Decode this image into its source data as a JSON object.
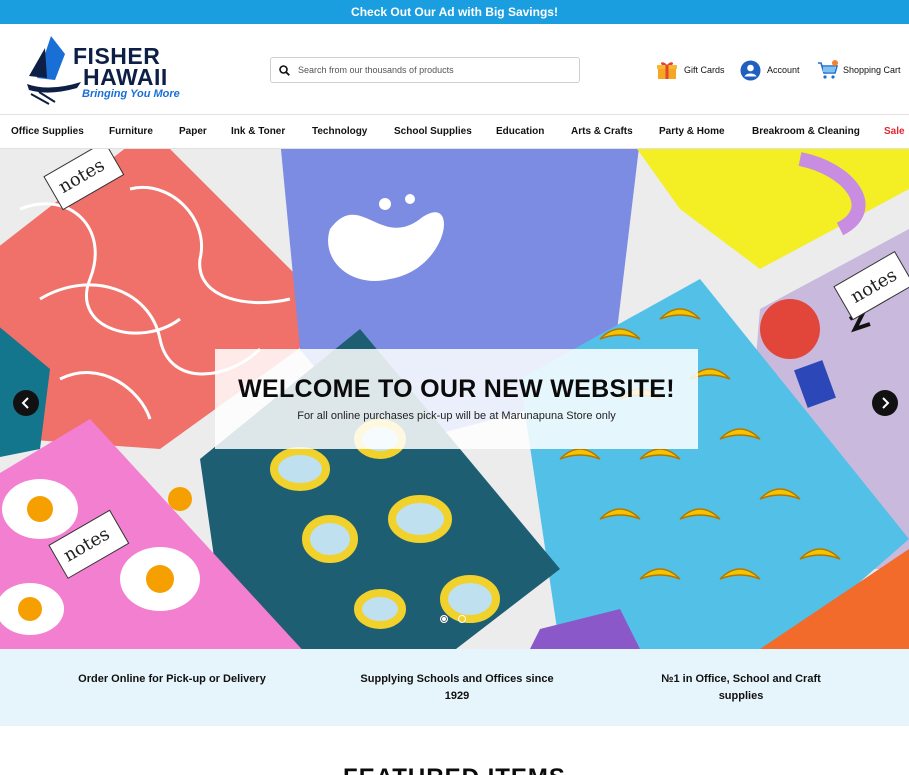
{
  "promo": {
    "text": "Check Out Our Ad with Big Savings!"
  },
  "header": {
    "logo_line1": "FISHER",
    "logo_line2": "HAWAII",
    "logo_tagline": "Bringing You More",
    "search_placeholder": "Search from our thousands of products",
    "gift_cards": "Gift Cards",
    "account": "Account",
    "shopping_cart": "Shopping Cart"
  },
  "nav": {
    "items": [
      "Office Supplies",
      "Furniture",
      "Paper",
      "Ink & Toner",
      "Technology",
      "School Supplies",
      "Education",
      "Arts & Crafts",
      "Party & Home",
      "Breakroom & Cleaning",
      "Sale"
    ]
  },
  "hero": {
    "title": "WELCOME TO OUR NEW WEBSITE!",
    "subtitle": "For all online purchases pick-up will be at Marunapuna Store only",
    "notebook_label": "notes",
    "slides_count": 2,
    "active_slide": 1
  },
  "features": [
    "Order Online for Pick-up or Delivery",
    "Supplying Schools and Offices since 1929",
    "№1 in Office, School and Craft supplies"
  ],
  "featured": {
    "title": "FEATURED ITEMS"
  },
  "colors": {
    "promo_bar": "#1a9ee0",
    "brand_navy": "#0d1f44",
    "brand_blue": "#1a6fd6",
    "sale_red": "#e0262f",
    "features_bg": "#e6f4fb"
  }
}
